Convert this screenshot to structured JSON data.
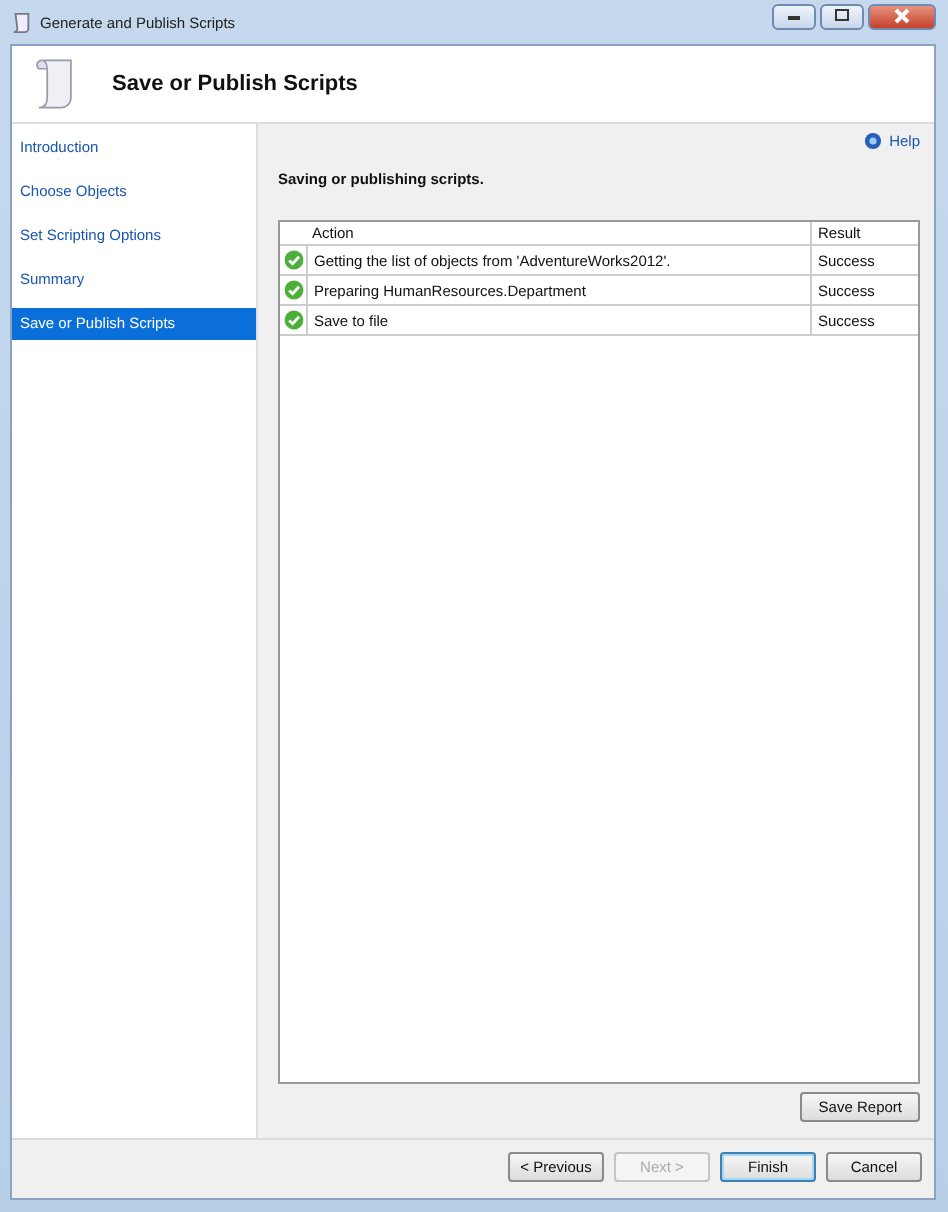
{
  "window": {
    "title": "Generate and Publish Scripts"
  },
  "header": {
    "title": "Save or Publish Scripts"
  },
  "sidebar": {
    "items": [
      {
        "label": "Introduction",
        "selected": false
      },
      {
        "label": "Choose Objects",
        "selected": false
      },
      {
        "label": "Set Scripting Options",
        "selected": false
      },
      {
        "label": "Summary",
        "selected": false
      },
      {
        "label": "Save or Publish Scripts",
        "selected": true
      }
    ]
  },
  "help": {
    "label": "Help"
  },
  "status": "Saving or publishing scripts.",
  "table": {
    "columns": [
      "Action",
      "Result"
    ],
    "rows": [
      {
        "action": "Getting the list of objects from 'AdventureWorks2012'.",
        "result": "Success",
        "kind": "success"
      },
      {
        "action": "Preparing HumanResources.Department",
        "result": "Success",
        "kind": "success"
      },
      {
        "action": "Save to file",
        "result": "Success",
        "kind": "success"
      }
    ]
  },
  "save_report": {
    "label": "Save Report"
  },
  "buttons": [
    {
      "label": "< Previous",
      "disabled": false,
      "default": false
    },
    {
      "label": "Next >",
      "disabled": true,
      "default": false
    },
    {
      "label": "Finish",
      "disabled": false,
      "default": true
    },
    {
      "label": "Cancel",
      "disabled": false,
      "default": false
    }
  ]
}
